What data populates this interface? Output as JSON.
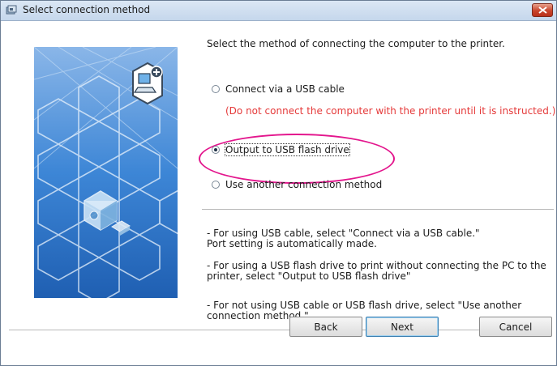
{
  "window": {
    "title": "Select connection method"
  },
  "heading": "Select the method of connecting the computer to the printer.",
  "options": [
    {
      "label": "Connect via a USB cable",
      "checked": false
    },
    {
      "label": "Output to USB flash drive",
      "checked": true
    },
    {
      "label": "Use another connection method",
      "checked": false
    }
  ],
  "warning": "(Do not connect the computer with the printer until it is instructed.)",
  "notes": [
    "- For using USB cable, select \"Connect via a USB cable.\"\nPort setting is automatically made.",
    "- For using a USB flash drive to print without connecting the PC to the\nprinter, select \"Output to USB flash drive\"",
    "- For not using USB cable or USB flash drive, select \"Use another\nconnection method.\""
  ],
  "buttons": {
    "back": "Back",
    "next": "Next",
    "cancel": "Cancel"
  },
  "colors": {
    "warning": "#e53a3a",
    "highlight_ellipse": "#e3168d",
    "art_blue": "#2e73c8"
  }
}
